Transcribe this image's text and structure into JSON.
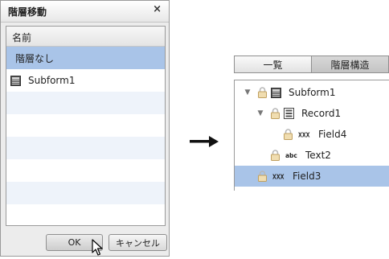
{
  "dialog": {
    "title": "階層移動",
    "close": "×",
    "column_header": "名前",
    "rows": [
      {
        "label": "階層なし",
        "icon": "none",
        "selected": true
      },
      {
        "label": "Subform1",
        "icon": "subform-icon",
        "selected": false
      }
    ],
    "ok_label": "OK",
    "cancel_label": "キャンセル"
  },
  "panel": {
    "tabs": [
      "一覧",
      "階層構造"
    ],
    "active_tab": "階層構造",
    "tree": [
      {
        "label": "Subform1",
        "icon": "subform-icon",
        "expanded": true,
        "level": 0
      },
      {
        "label": "Record1",
        "icon": "record-icon",
        "expanded": true,
        "level": 1
      },
      {
        "label": "Field4",
        "icon": "field-icon",
        "level": 2
      },
      {
        "label": "Text2",
        "icon": "text-icon",
        "level": 1
      },
      {
        "label": "Field3",
        "icon": "field-icon",
        "level": 0,
        "selected": true
      }
    ]
  },
  "colors": {
    "selection": "#a9c4e8",
    "alt_row": "#eef3fa"
  }
}
